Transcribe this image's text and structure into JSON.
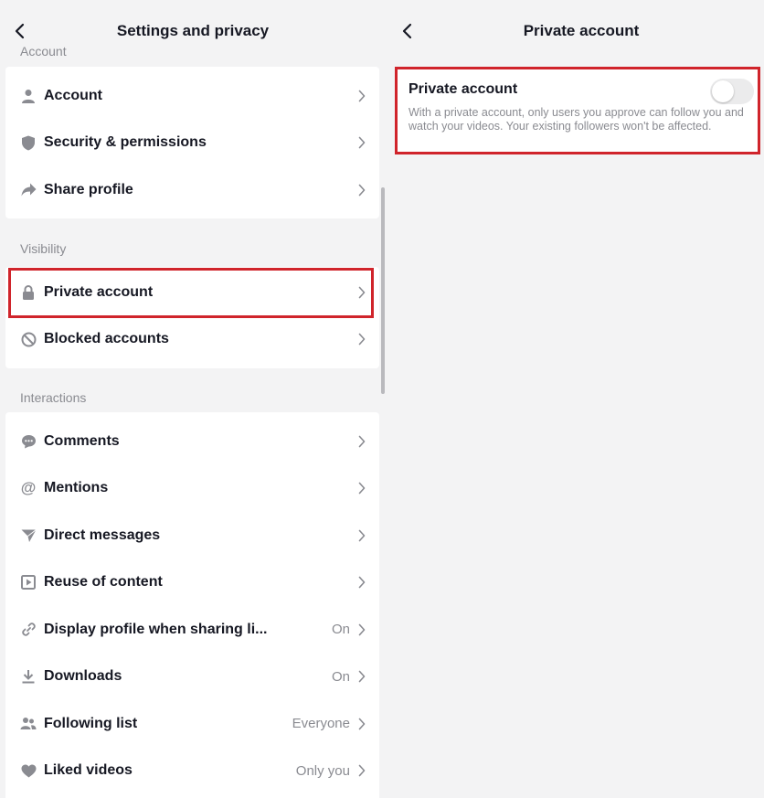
{
  "left_panel": {
    "title": "Settings and privacy",
    "cut_section_label": "Account",
    "account_items": [
      {
        "label": "Account",
        "icon": "person-icon"
      },
      {
        "label": "Security & permissions",
        "icon": "shield-icon"
      },
      {
        "label": "Share profile",
        "icon": "share-arrow-icon"
      }
    ],
    "visibility_label": "Visibility",
    "visibility_items": [
      {
        "label": "Private account",
        "icon": "lock-icon"
      },
      {
        "label": "Blocked accounts",
        "icon": "blocked-icon"
      }
    ],
    "interactions_label": "Interactions",
    "interaction_items": [
      {
        "label": "Comments",
        "value": "",
        "icon": "comment-icon"
      },
      {
        "label": "Mentions",
        "value": "",
        "icon": "at-icon"
      },
      {
        "label": "Direct messages",
        "value": "",
        "icon": "send-icon"
      },
      {
        "label": "Reuse of content",
        "value": "",
        "icon": "reuse-icon"
      },
      {
        "label": "Display profile when sharing li...",
        "value": "On",
        "icon": "link-icon"
      },
      {
        "label": "Downloads",
        "value": "On",
        "icon": "download-icon"
      },
      {
        "label": "Following list",
        "value": "Everyone",
        "icon": "people-icon"
      },
      {
        "label": "Liked videos",
        "value": "Only you",
        "icon": "heart-icon"
      }
    ]
  },
  "right_panel": {
    "title": "Private account",
    "setting_label": "Private account",
    "setting_description": "With a private account, only users you approve can follow you and watch your videos. Your existing followers won't be affected.",
    "toggle_on": false
  },
  "colors": {
    "background": "#f3f3f4",
    "card": "#ffffff",
    "highlight": "#d0242b",
    "secondary_text": "#8a8b91"
  }
}
